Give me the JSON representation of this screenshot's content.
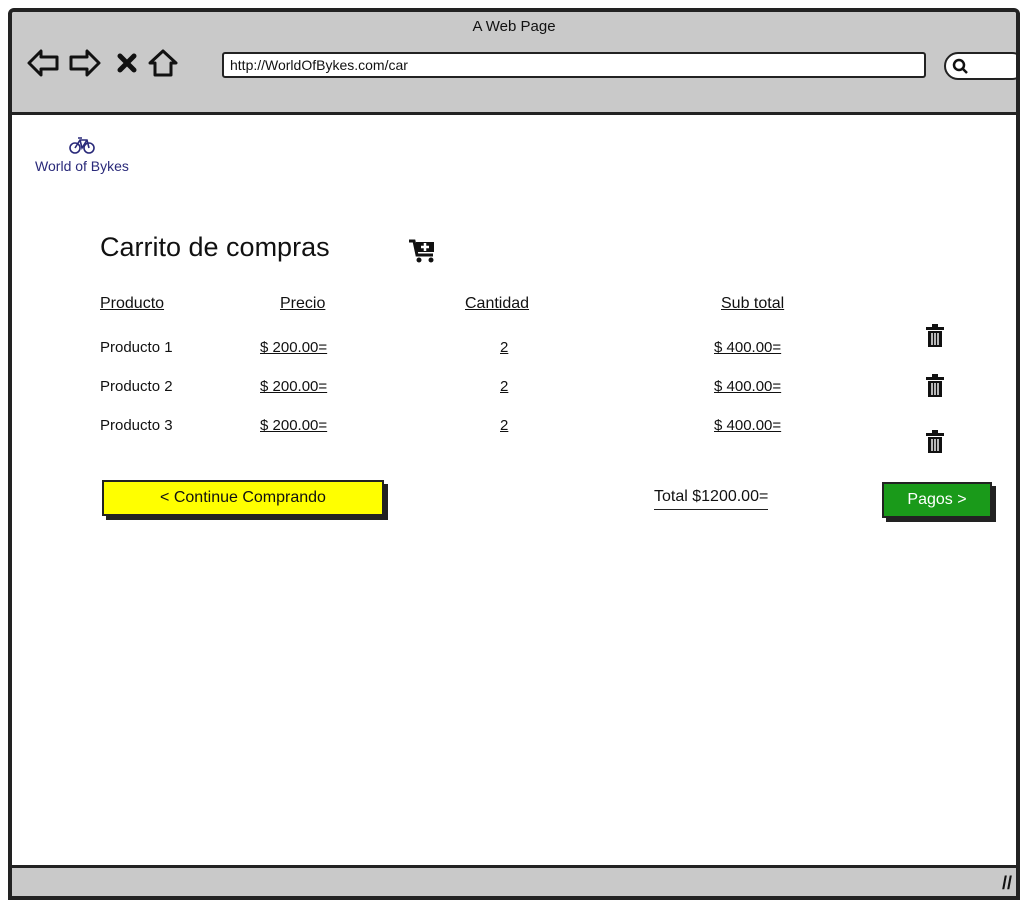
{
  "browser": {
    "window_title": "A Web Page",
    "url": "http://WorldOfBykes.com/car"
  },
  "logo": {
    "text": "World of Bykes",
    "icon": "bicycle-icon"
  },
  "page": {
    "title": "Carrito de compras",
    "title_icon": "cart-icon"
  },
  "table": {
    "headers": [
      "Producto",
      "Precio",
      "Cantidad",
      "Sub total"
    ],
    "rows": [
      {
        "product": "Producto 1",
        "price": "$ 200.00=",
        "quantity": "2",
        "subtotal": "$ 400.00="
      },
      {
        "product": "Producto 2",
        "price": "$ 200.00=",
        "quantity": "2",
        "subtotal": "$ 400.00="
      },
      {
        "product": "Producto 3",
        "price": "$ 200.00=",
        "quantity": "2",
        "subtotal": "$ 400.00="
      }
    ]
  },
  "actions": {
    "continue_label": "< Continue Comprando",
    "total_label": "Total $1200.00=",
    "pay_label": "Pagos >"
  },
  "colors": {
    "continue_button": "#ffff00",
    "pay_button": "#1a9a1a",
    "chrome": "#c9c9c9",
    "logo_text": "#2a2a7a"
  }
}
